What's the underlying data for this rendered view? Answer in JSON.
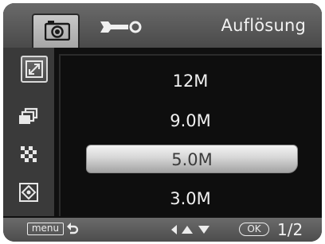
{
  "header": {
    "title": "Auflösung",
    "tabs": [
      {
        "icon": "camera-icon",
        "selected": true
      },
      {
        "icon": "wrench-icon",
        "selected": false
      }
    ]
  },
  "sidebar": {
    "items": [
      {
        "icon": "resize-icon",
        "selected": true
      },
      {
        "icon": "stacked-frames-icon",
        "selected": false
      },
      {
        "icon": "checker-grid-icon",
        "selected": false
      },
      {
        "icon": "focus-target-icon",
        "selected": false
      }
    ]
  },
  "options": [
    "12M",
    "9.0M",
    "5.0M",
    "3.0M"
  ],
  "selected_option": "5.0M",
  "footer": {
    "menu_label": "menu",
    "ok_label": "OK",
    "page": "1/2"
  },
  "colors": {
    "background": "#101010",
    "bar": "#5a5a5a",
    "highlight": "#d6d6d6"
  }
}
